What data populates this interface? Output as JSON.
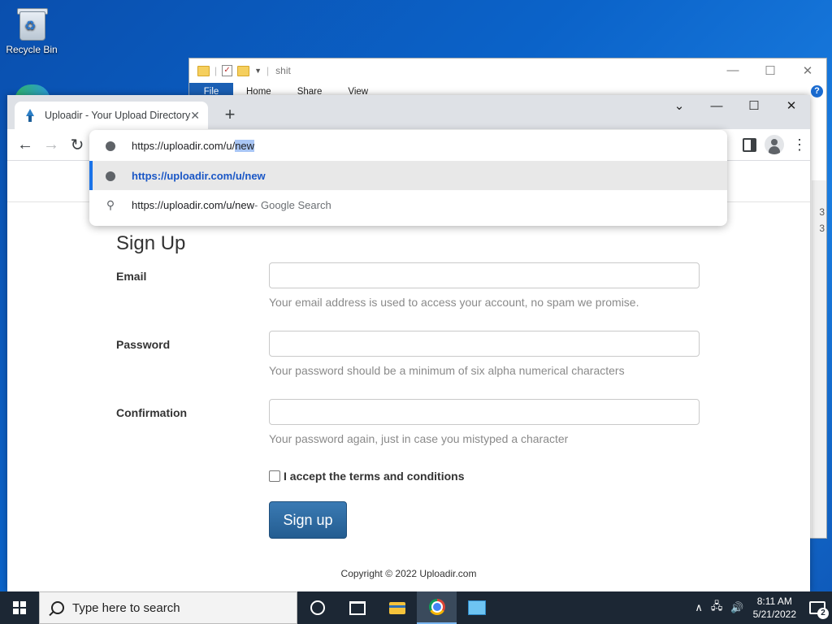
{
  "desktop": {
    "recycle_bin_label": "Recycle Bin"
  },
  "explorer": {
    "title": "shit",
    "tabs": [
      "File",
      "Home",
      "Share",
      "View"
    ],
    "min_glyph": "—",
    "max_glyph": "☐",
    "close_glyph": "✕",
    "help_glyph": "?",
    "side_text_1": "3",
    "side_text_2": "3"
  },
  "browser": {
    "tab_title": "Uploadir - Your Upload Directory",
    "tab_close_glyph": "✕",
    "new_tab_glyph": "+",
    "tab_search_glyph": "⌄",
    "min_glyph": "—",
    "max_glyph": "☐",
    "close_glyph": "✕",
    "back_glyph": "←",
    "forward_glyph": "→",
    "reload_glyph": "↻",
    "kebab_glyph": "⋮",
    "omnibox": {
      "input_prefix": "https://uploadir.com/u/",
      "input_selected": "new",
      "suggestions": [
        {
          "text": "https://uploadir.com/u/new",
          "suffix": "",
          "icon": "globe-icon",
          "selected": true
        },
        {
          "text": "https://uploadir.com/u/new",
          "suffix": " - Google Search",
          "icon": "search-icon",
          "selected": false
        }
      ],
      "search_glyph": "🔍"
    }
  },
  "page": {
    "title": "Sign Up",
    "fields": [
      {
        "label": "Email",
        "help": "Your email address is used to access your account, no spam we promise.",
        "value": ""
      },
      {
        "label": "Password",
        "help": "Your password should be a minimum of six alpha numerical characters",
        "value": ""
      },
      {
        "label": "Confirmation",
        "help": "Your password again, just in case you mistyped a character",
        "value": ""
      }
    ],
    "terms_label": "I accept the terms and conditions",
    "terms_checked": false,
    "submit_label": "Sign up",
    "copyright": "Copyright © 2022 Uploadir.com"
  },
  "taskbar": {
    "search_placeholder": "Type here to search",
    "time": "8:11 AM",
    "date": "5/21/2022",
    "notification_count": "2",
    "tray_chevron": "∧",
    "network_glyph": "🖧",
    "volume_glyph": "🔊"
  }
}
